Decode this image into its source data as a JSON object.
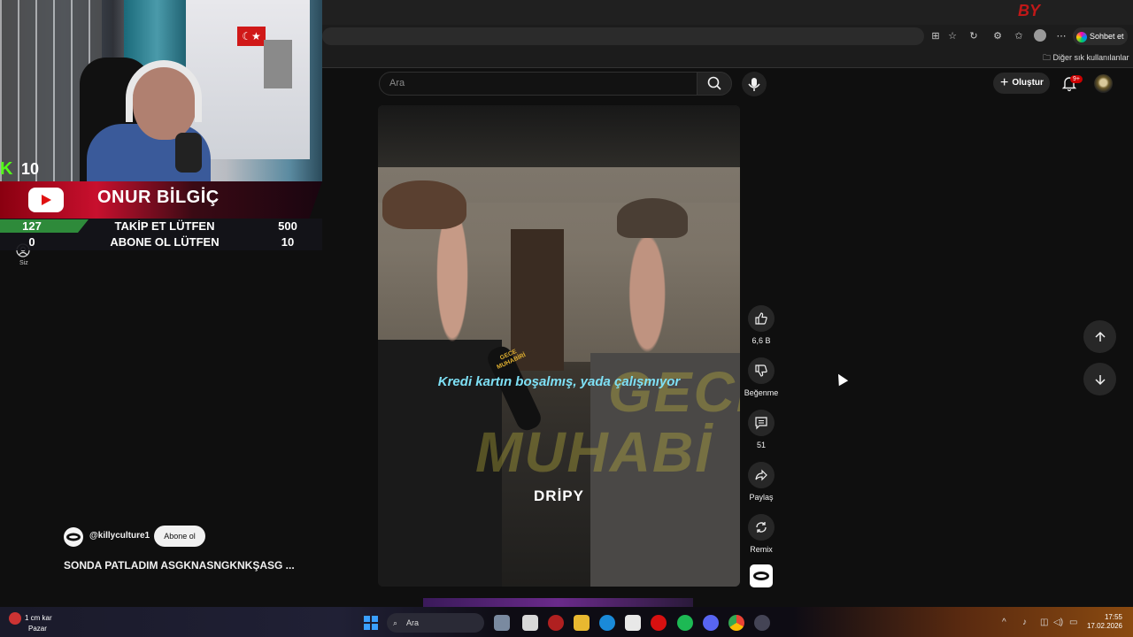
{
  "browser": {
    "copilot_label": "Sohbet et",
    "bookmarks_folder": "Diğer sık kullanılanlar"
  },
  "youtube": {
    "search_placeholder": "Ara",
    "create_label": "Oluştur",
    "notification_badge": "9+",
    "you_label": "Siz"
  },
  "short": {
    "subtitle": "Kredi kartın boşalmış, yada çalışmıyor",
    "watermark_line1": "GECE",
    "watermark_line2": "MUHABİ",
    "mic_label_line1": "GECE",
    "mic_label_line2": "MUHABİRİ",
    "brand": "DRİPY",
    "channel_name": "@killyculture1",
    "subscribe_label": "Abone ol",
    "title": "SONDA PATLADIM ASGKNASNGKNKŞASG ...",
    "actions": {
      "like_count": "6,6 B",
      "dislike_label": "Beğenme",
      "comment_count": "51",
      "share_label": "Paylaş",
      "remix_label": "Remix"
    }
  },
  "stream_overlay": {
    "kick_logo": "K",
    "kick_viewers": "10",
    "streamer_name": "ONUR BİLGİÇ",
    "goals": [
      {
        "count": "127",
        "text": "TAKİP ET LÜTFEN",
        "target": "500"
      },
      {
        "count": "0",
        "text": "ABONE OL LÜTFEN",
        "target": "10"
      }
    ]
  },
  "recorder_watermark": "BY",
  "taskbar": {
    "weather_line1": "1 cm kar",
    "weather_line2": "Pazar",
    "search_placeholder": "Ara",
    "time": "17:55",
    "date": "17.02.2026"
  }
}
